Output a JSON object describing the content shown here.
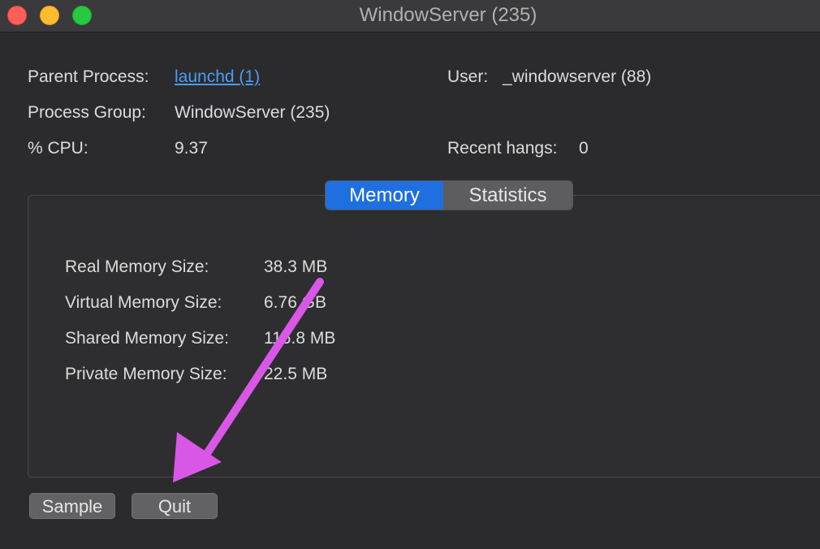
{
  "window": {
    "title": "WindowServer (235)"
  },
  "info": {
    "parent_process_label": "Parent Process:",
    "parent_process_value": "launchd (1)",
    "process_group_label": "Process Group:",
    "process_group_value": "WindowServer (235)",
    "cpu_label": "% CPU:",
    "cpu_value": "9.37",
    "user_label": "User:",
    "user_value": "_windowserver (88)",
    "recent_hangs_label": "Recent hangs:",
    "recent_hangs_value": "0"
  },
  "tabs": [
    {
      "label": "Memory",
      "selected": true
    },
    {
      "label": "Statistics",
      "selected": false
    }
  ],
  "memory": {
    "rows": [
      {
        "label": "Real Memory Size:",
        "value": "38.3 MB"
      },
      {
        "label": "Virtual Memory Size:",
        "value": "6.76 GB"
      },
      {
        "label": "Shared Memory Size:",
        "value": "116.8 MB"
      },
      {
        "label": "Private Memory Size:",
        "value": "22.5 MB"
      }
    ]
  },
  "buttons": {
    "sample": "Sample",
    "quit": "Quit"
  },
  "colors": {
    "accent": "#1e6fe0",
    "link": "#4a9cf5",
    "annotation_arrow": "#d957e6"
  }
}
